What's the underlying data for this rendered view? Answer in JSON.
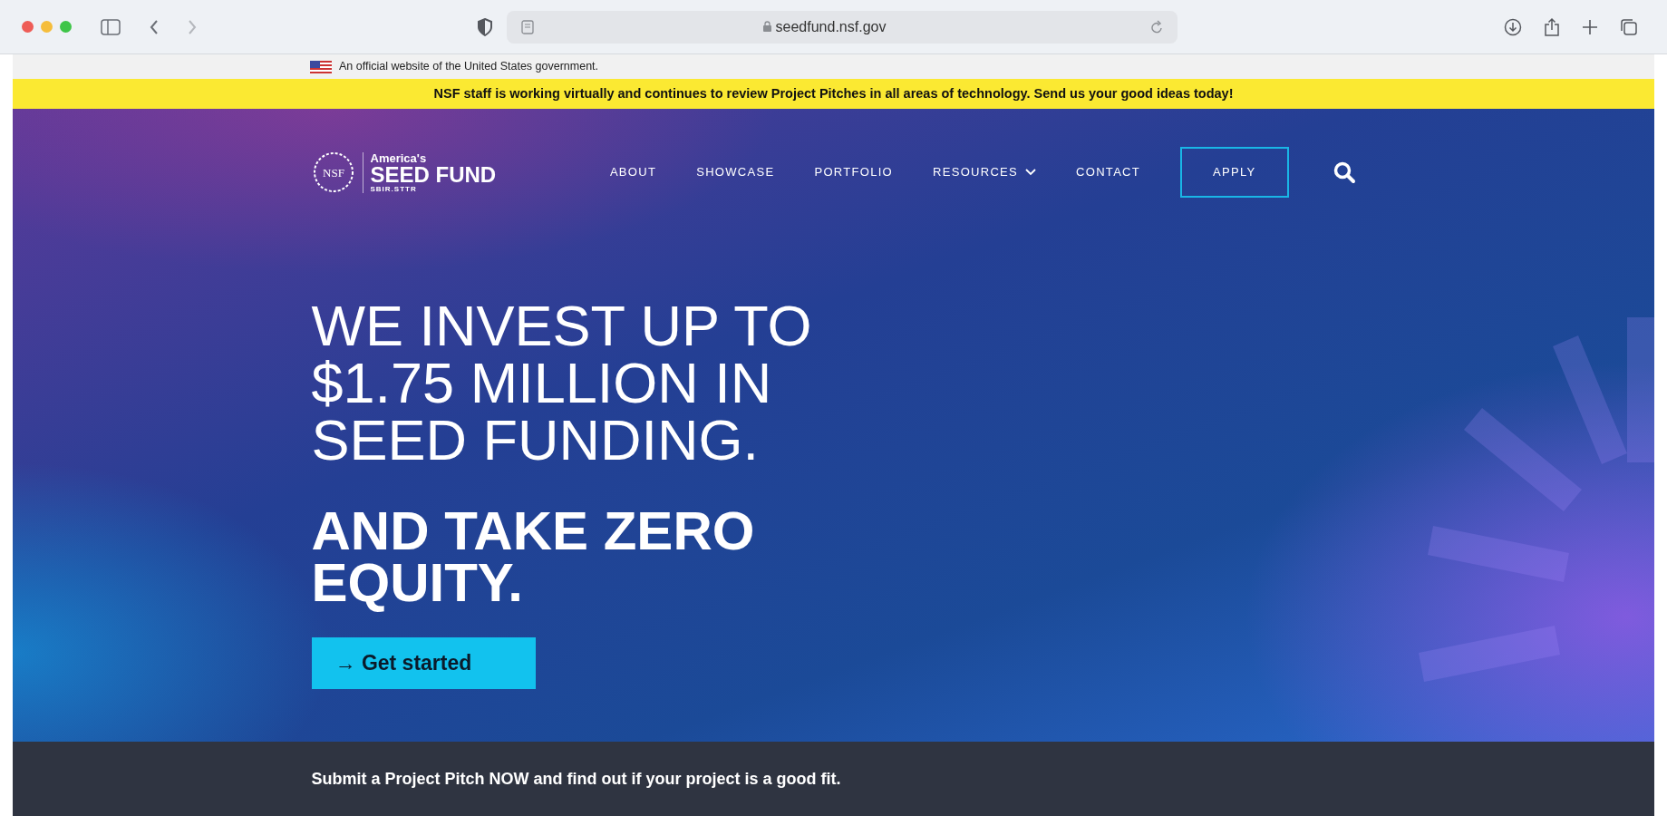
{
  "browser": {
    "url": "seedfund.nsf.gov"
  },
  "gov_banner": {
    "text": "An official website of the United States government."
  },
  "alert": {
    "text": "NSF staff is working virtually and continues to review Project Pitches in all areas of technology. Send us your good ideas today!"
  },
  "logo": {
    "seal": "NSF",
    "tagline": "America's",
    "name": "SEED FUND",
    "sub": "SBIR.STTR"
  },
  "nav": [
    {
      "label": "ABOUT",
      "kind": "link"
    },
    {
      "label": "SHOWCASE",
      "kind": "link"
    },
    {
      "label": "PORTFOLIO",
      "kind": "link"
    },
    {
      "label": "RESOURCES",
      "kind": "dropdown"
    },
    {
      "label": "CONTACT",
      "kind": "link"
    },
    {
      "label": "APPLY",
      "kind": "outlined"
    }
  ],
  "hero": {
    "headline": "WE INVEST UP TO $1.75 MILLION IN SEED FUNDING.",
    "subheadline": "AND TAKE ZERO EQUITY.",
    "button": {
      "icon": "→",
      "label": "Get started"
    }
  },
  "cta_bar": {
    "text": "Submit a Project Pitch NOW and find out if your project is a good fit."
  }
}
